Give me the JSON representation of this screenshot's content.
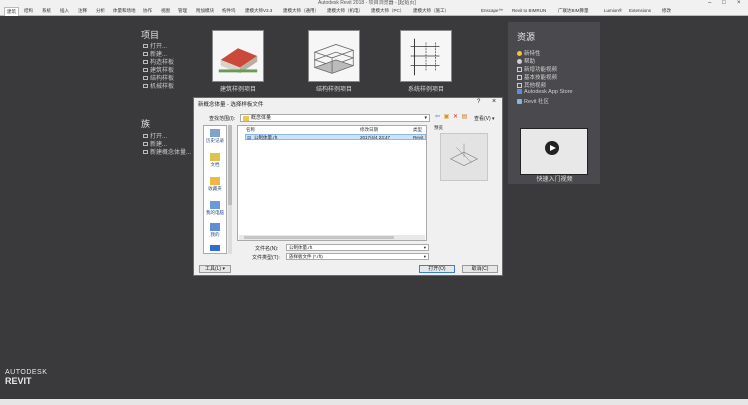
{
  "app": {
    "window_title": "Autodesk Revit 2018 - 项目浏览器 - [起始页]",
    "ribbon_tabs": [
      "建筑",
      "结构",
      "系统",
      "插入",
      "注释",
      "分析",
      "体量和场地",
      "协作",
      "视图",
      "管理",
      "附加模块",
      "构件坞",
      "建模大师V3.3",
      "建模大师（通用）",
      "建模大师（机电）",
      "建模大师（PC）",
      "建模大师（施工）",
      "Enscape™",
      "Revit to BIMRUN",
      "广联达BIM算量",
      "Lumion®",
      "Extensions",
      "修改"
    ]
  },
  "projects": {
    "title": "项目",
    "links": [
      "打开...",
      "新建...",
      "构造样板",
      "建筑样板",
      "结构样板",
      "机械样板"
    ],
    "thumbnails": [
      "建筑样例项目",
      "结构样例项目",
      "系统样例项目"
    ]
  },
  "families": {
    "title": "族",
    "links": [
      "打开...",
      "新建...",
      "新建概念体量..."
    ]
  },
  "resources": {
    "title": "资源",
    "items": [
      "新特性",
      "帮助",
      "新增功能视频",
      "基本技能视频",
      "其他视频",
      "Autodesk App Store",
      "Revit 社区"
    ],
    "video_caption": "快速入门视频"
  },
  "logo": {
    "line1": "AUTODESK",
    "line2": "REVIT"
  },
  "dialog": {
    "title": "新概念体量 - 选择样板文件",
    "help": "?",
    "close": "×",
    "lookin_label": "查找范围(I):",
    "lookin_value": "概念体量",
    "views_label": "查看(V)",
    "places": [
      "历史记录",
      "文档",
      "收藏夹",
      "我的电脑",
      "我的"
    ],
    "columns": [
      "名称",
      "修改日期",
      "类型"
    ],
    "file": {
      "name": "公制体量.rft",
      "date": "2017/4/4 23:47",
      "type": "Revit"
    },
    "preview_label": "预览",
    "filename_label": "文件名(N):",
    "filename_value": "公制体量.rft",
    "filetype_label": "文件类型(T):",
    "filetype_value": "族样板文件 (*.rft)",
    "tools_label": "工具(L)",
    "open_label": "打开(O)",
    "cancel_label": "取消(C)"
  },
  "colors": {
    "background": "#3a3a3d",
    "panel": "#4a4a4e",
    "accent": "#3c7fd1",
    "selection": "#cde3f7"
  }
}
